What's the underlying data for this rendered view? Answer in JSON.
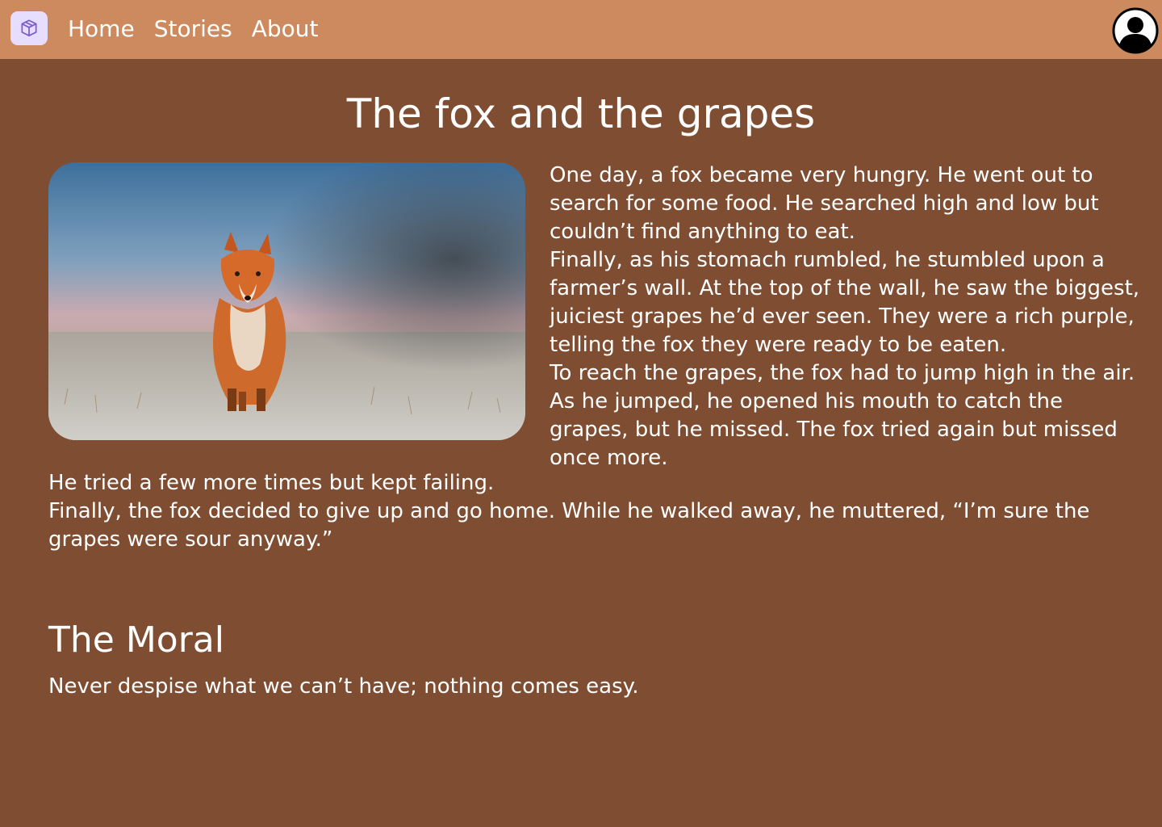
{
  "nav": {
    "links": [
      "Home",
      "Stories",
      "About"
    ]
  },
  "icons": {
    "logo": "cube-icon",
    "profile": "user-circle-icon"
  },
  "colors": {
    "navbar": "#cd8a5e",
    "background": "#7f4d32",
    "logo_bg": "#e7ddff",
    "logo_icon": "#7c5cc9",
    "text": "#ffffff"
  },
  "story": {
    "title": "The fox and the grapes",
    "paragraphs_beside_image": [
      "One day, a fox became very hungry. He went out to search for some food. He searched high and low but couldn’t find anything to eat.",
      "Finally, as his stomach rumbled, he stumbled upon a farmer’s wall. At the top of the wall, he saw the biggest, juiciest grapes he’d ever seen. They were a rich purple, telling the fox they were ready to be eaten.",
      "To reach the grapes, the fox had to jump high in the air. As he jumped, he opened his mouth to catch the grapes, but he missed. The fox tried again but missed once more."
    ],
    "paragraphs_below": [
      "He tried a few more times but kept failing.",
      "Finally, the fox decided to give up and go home. While he walked away, he muttered, “I’m sure the grapes were sour anyway.”"
    ]
  },
  "moral": {
    "heading": "The Moral",
    "text": "Never despise what we can’t have; nothing comes easy."
  }
}
